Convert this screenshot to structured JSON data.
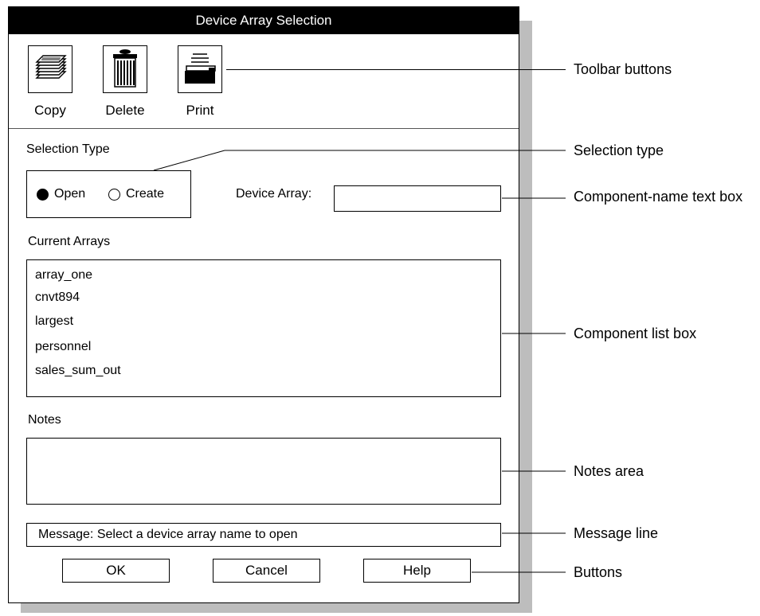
{
  "window": {
    "title": "Device Array Selection"
  },
  "toolbar": {
    "copy_label": "Copy",
    "delete_label": "Delete",
    "print_label": "Print",
    "icons": {
      "copy": "stacked-pages-icon",
      "delete": "trash-can-icon",
      "print": "printer-icon"
    }
  },
  "selection_type": {
    "label": "Selection Type",
    "options": [
      "Open",
      "Create"
    ],
    "selected": "Open"
  },
  "device_array": {
    "label": "Device Array:",
    "value": ""
  },
  "current_arrays": {
    "label": "Current Arrays",
    "items": [
      "array_one",
      "cnvt894",
      "largest",
      "personnel",
      "sales_sum_out"
    ]
  },
  "notes": {
    "label": "Notes",
    "value": ""
  },
  "message": {
    "text": "Message:  Select a device array name to open"
  },
  "buttons": {
    "ok": "OK",
    "cancel": "Cancel",
    "help": "Help"
  },
  "callouts": {
    "toolbar": "Toolbar buttons",
    "selection_type": "Selection type",
    "component_name": "Component-name text box",
    "component_list": "Component list box",
    "notes_area": "Notes area",
    "message_line": "Message line",
    "buttons": "Buttons"
  }
}
